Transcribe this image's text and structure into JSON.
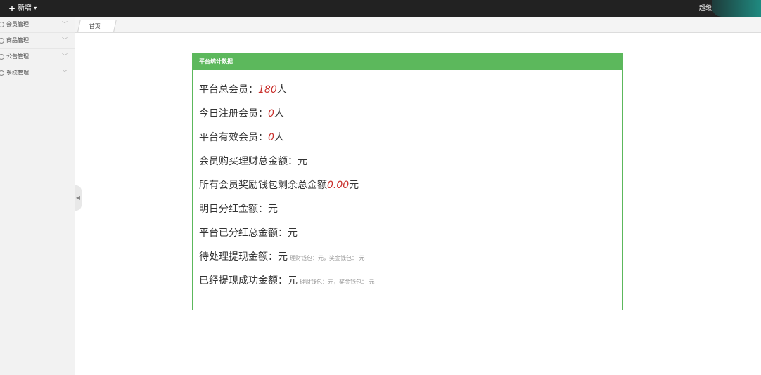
{
  "topbar": {
    "new_label": "新增",
    "user_name": "超级"
  },
  "sidebar": {
    "items": [
      {
        "label": "会员管理"
      },
      {
        "label": "商品管理"
      },
      {
        "label": "公告管理"
      },
      {
        "label": "系统管理"
      }
    ]
  },
  "tabs": [
    {
      "label": "首页"
    }
  ],
  "panel": {
    "title": "平台统计数据",
    "stats": {
      "total_members": {
        "label": "平台总会员：",
        "value": "180",
        "unit": "人"
      },
      "today_members": {
        "label": "今日注册会员：",
        "value": "0",
        "unit": "人"
      },
      "valid_members": {
        "label": "平台有效会员：",
        "value": "0",
        "unit": "人"
      },
      "finance_total": {
        "label": "会员购买理财总金额：",
        "value": "",
        "unit": "元"
      },
      "wallet_remain": {
        "label": "所有会员奖励钱包剩余总金额",
        "value": "0.00",
        "unit": "元"
      },
      "tomorrow_dividend": {
        "label": "明日分红金额：",
        "value": "",
        "unit": "元"
      },
      "dividend_total": {
        "label": "平台已分红总金额：",
        "value": "",
        "unit": "元"
      },
      "pending_withdraw": {
        "label": "待处理提现金额：",
        "value": "",
        "unit": "元",
        "sub": "理财钱包：元，奖金钱包： 元"
      },
      "done_withdraw": {
        "label": "已经提现成功金额：",
        "value": "",
        "unit": "元",
        "sub": "理财钱包：元，奖金钱包： 元"
      }
    }
  },
  "colors": {
    "accent": "#5cb85c",
    "number": "#c9302c",
    "topbar": "#222222"
  }
}
